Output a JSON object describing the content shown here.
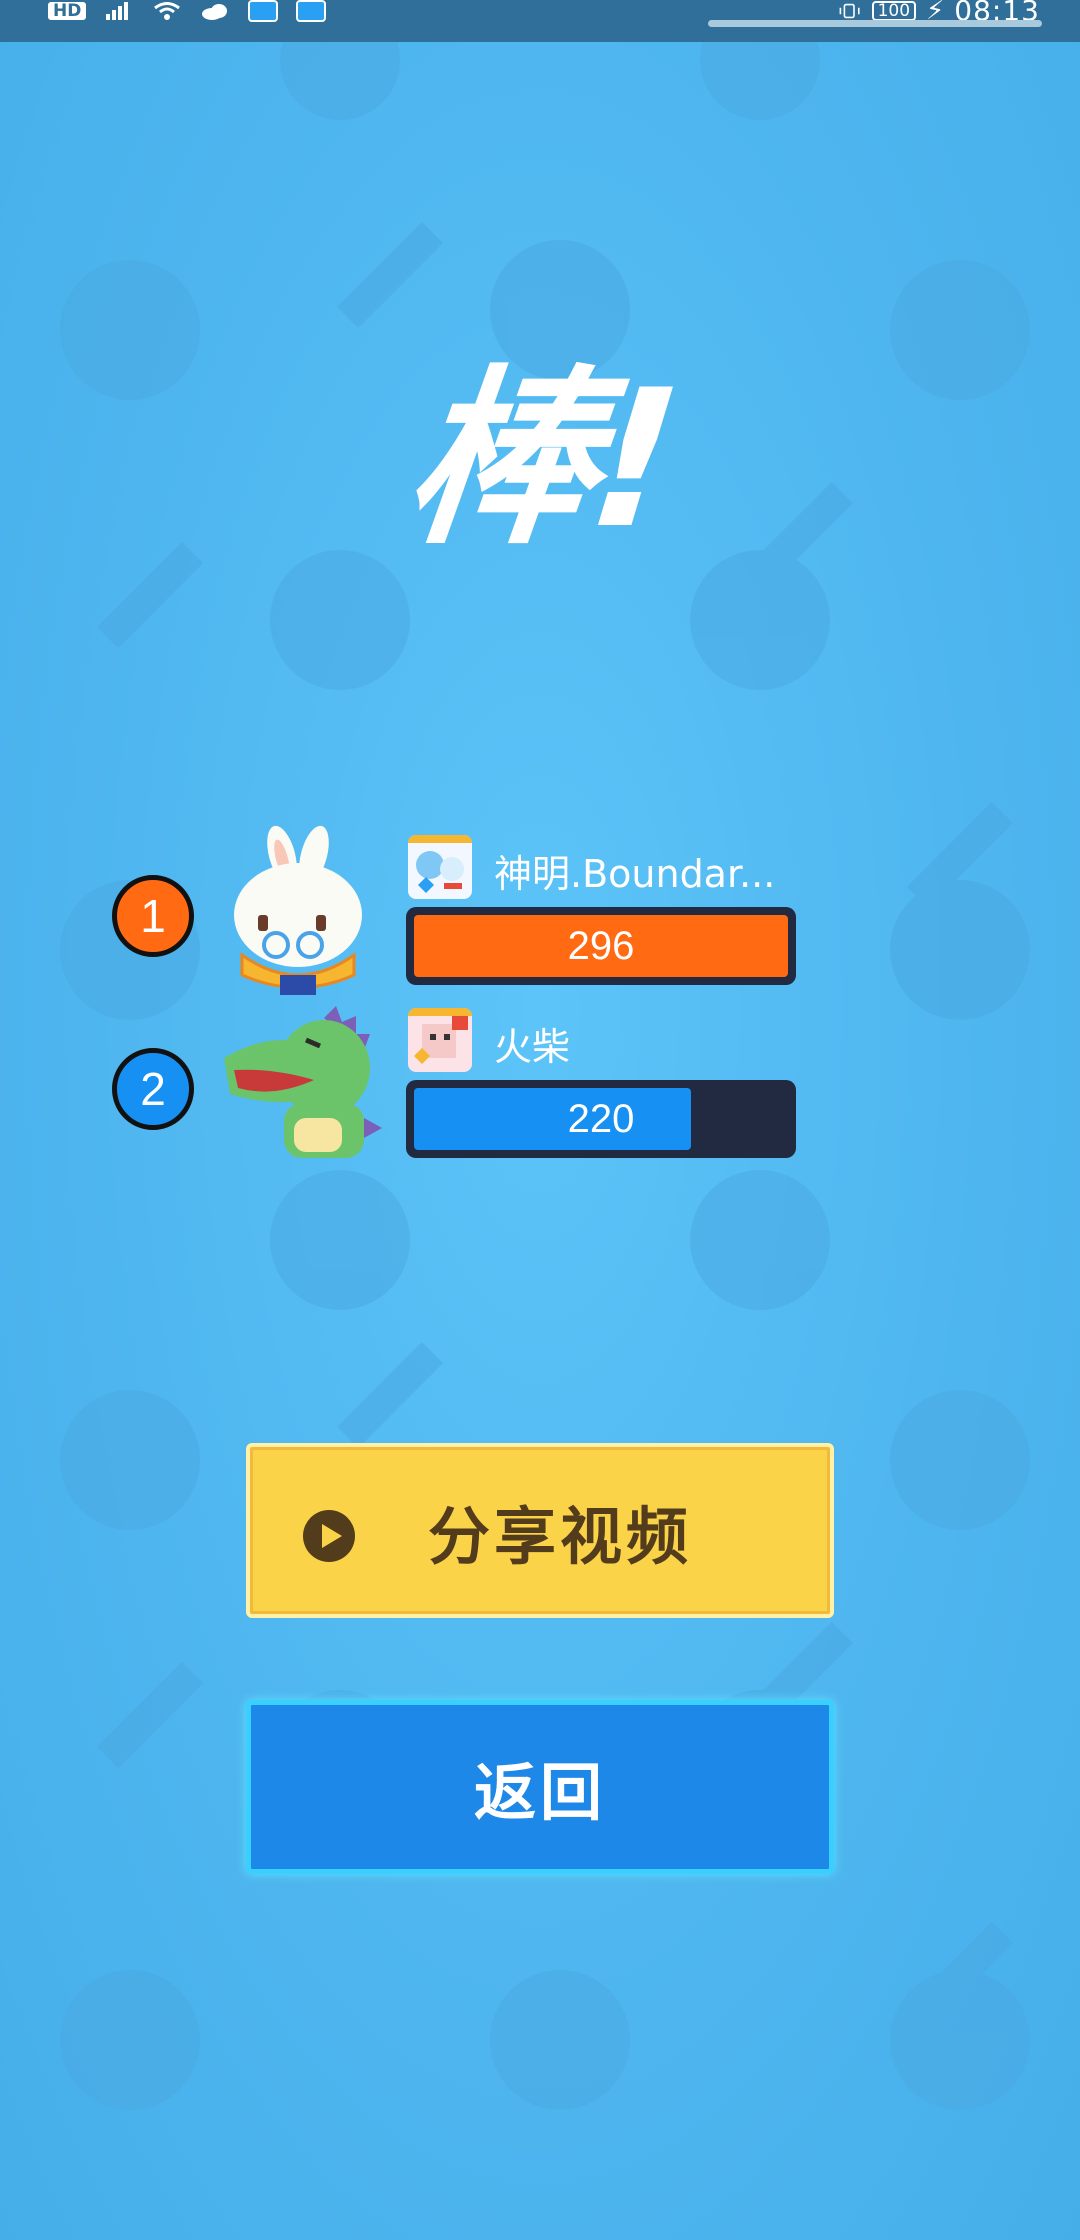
{
  "status_bar": {
    "hd_label": "HD",
    "battery": "100",
    "time": "08:13"
  },
  "title": "棒!",
  "players": [
    {
      "rank": "1",
      "name": "神明.Boundar...",
      "score": "296",
      "fill_fraction": 1.0,
      "color": "#ff6a13",
      "badge_color": "#ff6a13"
    },
    {
      "rank": "2",
      "name": "火柴",
      "score": "220",
      "fill_fraction": 0.74,
      "color": "#1690f2",
      "badge_color": "#1690f2"
    }
  ],
  "buttons": {
    "share_label": "分享视频",
    "back_label": "返回"
  },
  "colors": {
    "background": "#52b7f0",
    "share_button": "#fbd349",
    "back_button": "#1e88e8"
  }
}
